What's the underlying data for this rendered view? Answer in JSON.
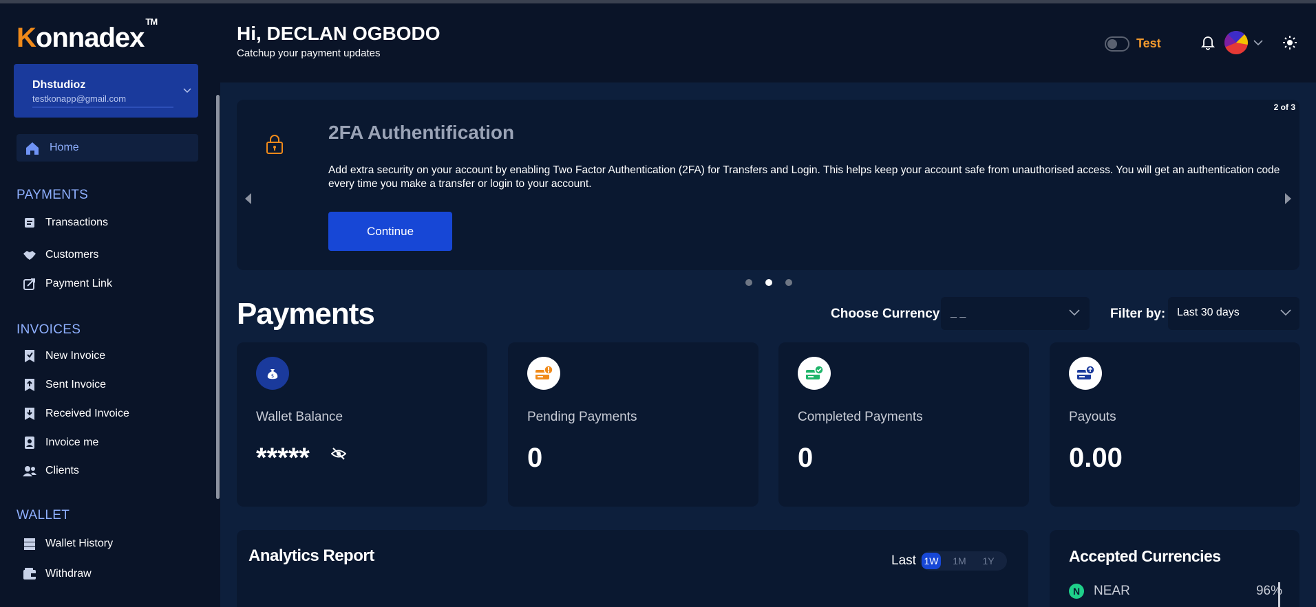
{
  "brand": {
    "logo_first": "K",
    "logo_rest": "onnadex",
    "trademark": "TM"
  },
  "account": {
    "name": "Dhstudioz",
    "email": "testkonapp@gmail.com"
  },
  "sidebar": {
    "home": "Home",
    "sections": {
      "payments": "PAYMENTS",
      "invoices": "INVOICES",
      "wallet": "WALLET"
    },
    "payments_items": [
      "Transactions",
      "Customers",
      "Payment Link"
    ],
    "invoices_items": [
      "New Invoice",
      "Sent Invoice",
      "Received Invoice",
      "Invoice me",
      "Clients"
    ],
    "wallet_items": [
      "Wallet History",
      "Withdraw"
    ]
  },
  "header": {
    "greeting": "Hi, DECLAN OGBODO",
    "subtitle": "Catchup your payment updates",
    "mode_label": "Test"
  },
  "banner": {
    "counter": "2 of 3",
    "title": "2FA Authentification",
    "text": "Add extra security on your account by enabling Two Factor Authentication (2FA) for Transfers and Login. This helps keep your account safe from unauthorised access. You will get an authentication code every time you make a transfer or login to your account.",
    "button": "Continue",
    "active_slide": 2,
    "total_slides": 3
  },
  "payments": {
    "title": "Payments",
    "currency_label": "Choose Currency:",
    "currency_value": "_ _",
    "filter_label": "Filter by:",
    "filter_value": "Last 30 days"
  },
  "cards": [
    {
      "label": "Wallet Balance",
      "value": "*****"
    },
    {
      "label": "Pending Payments",
      "value": "0"
    },
    {
      "label": "Completed Payments",
      "value": "0"
    },
    {
      "label": "Payouts",
      "value": "0.00"
    }
  ],
  "analytics": {
    "title": "Analytics Report",
    "last_label": "Last",
    "ranges": [
      "1W",
      "1M",
      "1Y"
    ],
    "selected_range": "1W"
  },
  "currencies": {
    "title": "Accepted Currencies",
    "items": [
      {
        "symbol": "N",
        "name": "NEAR",
        "percent": "96%"
      }
    ]
  },
  "colors": {
    "background": "#0a1428",
    "panel": "#0a1830",
    "accent_blue": "#1747d6",
    "accent_orange": "#f29a2e",
    "nav_blue": "#8fb0ff"
  }
}
